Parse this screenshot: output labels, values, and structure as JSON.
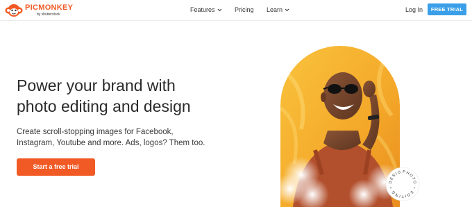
{
  "brand": {
    "name": "PICMONKEY",
    "tagline": "by shutterstock",
    "color": "#f15a24"
  },
  "nav": {
    "items": [
      {
        "label": "Features",
        "has_dropdown": true
      },
      {
        "label": "Pricing",
        "has_dropdown": false
      },
      {
        "label": "Learn",
        "has_dropdown": true
      }
    ],
    "login_label": "Log In",
    "trial_label": "FREE TRIAL",
    "trial_color": "#3a9fe8"
  },
  "hero": {
    "headline_lines": [
      "Power your brand with",
      "photo editing and design"
    ],
    "subtext_lines": [
      "Create scroll-stopping images for Facebook,",
      "Instagram, Youtube and more. Ads, logos? Them too."
    ],
    "cta_label": "Start a free trial",
    "cta_color": "#f15a24"
  },
  "image": {
    "stamp_text": "PHOTO • EDITING • DESIGN •",
    "icons": [
      "monkey-logo-icon",
      "chevron-down-icon"
    ]
  }
}
